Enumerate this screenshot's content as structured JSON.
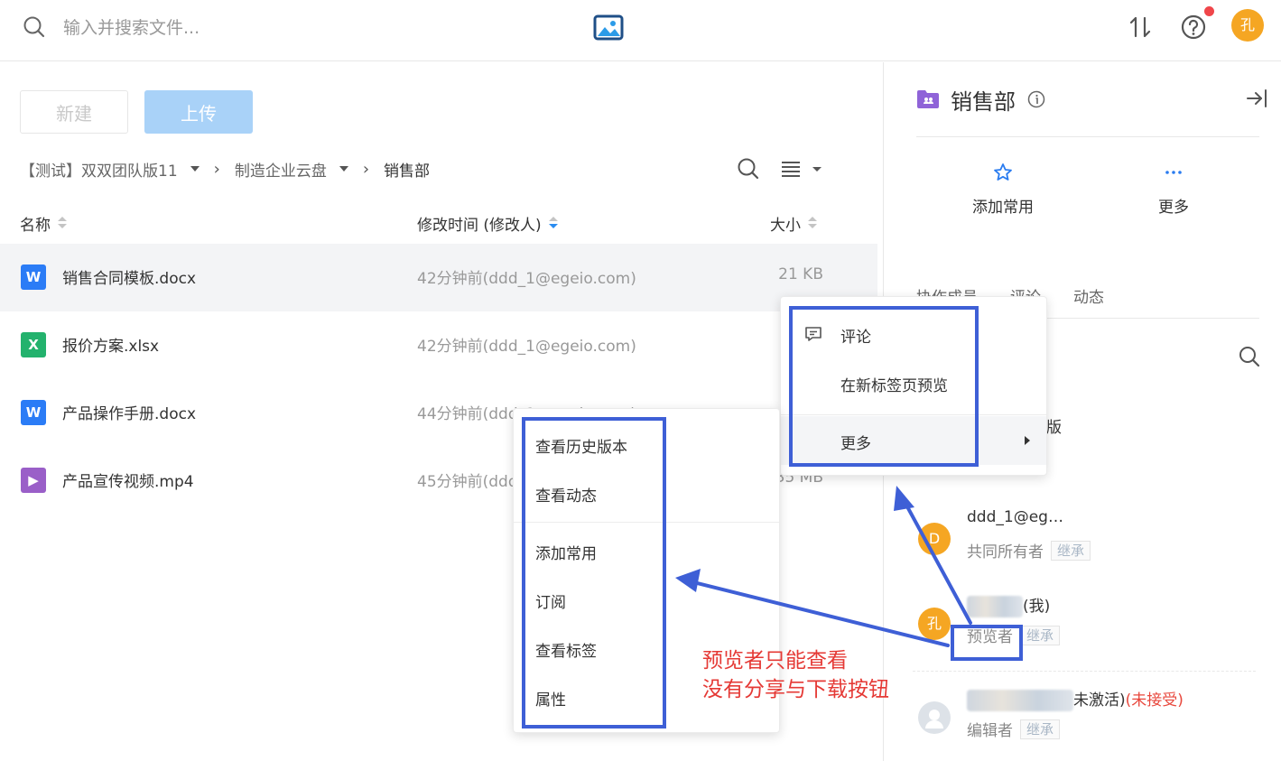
{
  "topbar": {
    "search_placeholder": "输入并搜索文件...",
    "avatar_text": "孔",
    "icons": [
      "search-icon",
      "image-logo-icon",
      "transfer-sort-icon",
      "help-icon",
      "notification-dot",
      "avatar"
    ]
  },
  "toolbar": {
    "new_label": "新建",
    "upload_label": "上传"
  },
  "breadcrumb": {
    "items": [
      "【测试】双双团队版11",
      "制造企业云盘",
      "销售部"
    ]
  },
  "table": {
    "columns": {
      "name": "名称",
      "modified": "修改时间 (修改人)",
      "size": "大小"
    },
    "rows": [
      {
        "icon": "word",
        "icon_text": "W",
        "name": "销售合同模板.docx",
        "time": "42分钟前(ddd_1@egeio.com)",
        "size": "21 KB"
      },
      {
        "icon": "excel",
        "icon_text": "X",
        "name": "报价方案.xlsx",
        "time": "42分钟前(ddd_1@egeio.com)",
        "size": ""
      },
      {
        "icon": "word",
        "icon_text": "W",
        "name": "产品操作手册.docx",
        "time": "44分钟前(ddd_1@egeio.com)",
        "size": ""
      },
      {
        "icon": "video",
        "icon_text": "▶",
        "name": "产品宣传视频.mp4",
        "time": "45分钟前(ddd",
        "size": "35 MB"
      }
    ]
  },
  "right_panel": {
    "title": "销售部",
    "actions": {
      "favorite": "添加常用",
      "more": "更多"
    },
    "tabs": [
      "协作成员",
      "评论",
      "动态"
    ],
    "partial_text": "版",
    "members": [
      {
        "avatar": "D",
        "name": "ddd_1@eg…",
        "role": "共同所有者",
        "badge": "继承"
      },
      {
        "avatar": "孔",
        "name": "(我)",
        "role": "预览者",
        "badge": "继承"
      },
      {
        "avatar": "",
        "name": "未激活)",
        "status": "(未接受)",
        "role": "编辑者",
        "badge": "继承"
      }
    ]
  },
  "context_menu_main": {
    "items": [
      "评论",
      "在新标签页预览",
      "更多"
    ]
  },
  "context_menu_sub": {
    "items": [
      "查看历史版本",
      "查看动态",
      "添加常用",
      "订阅",
      "查看标签",
      "属性"
    ]
  },
  "annotation": {
    "line1": "预览者只能查看",
    "line2": "没有分享与下载按钮",
    "color": "#e53935",
    "box_color": "#3e5fd6"
  }
}
